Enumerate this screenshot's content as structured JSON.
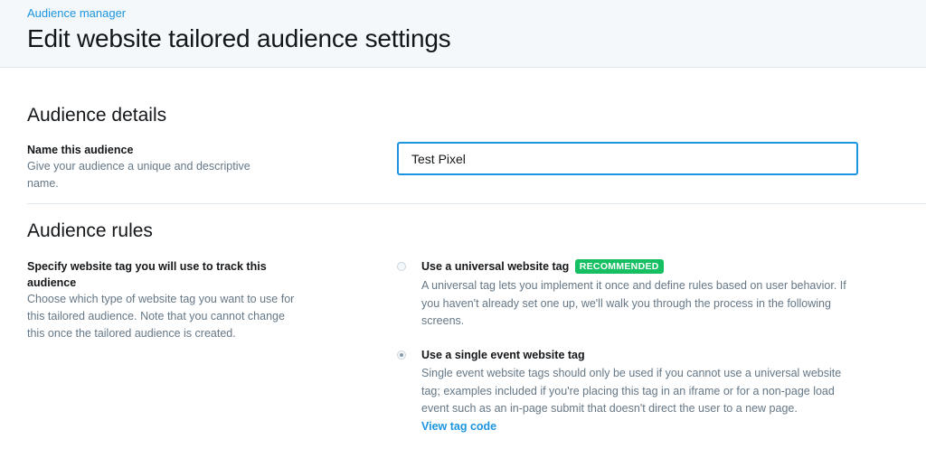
{
  "header": {
    "breadcrumb": "Audience manager",
    "title": "Edit website tailored audience settings"
  },
  "audience_details": {
    "title": "Audience details",
    "name_label": "Name this audience",
    "name_help": "Give your audience a unique and descriptive name.",
    "name_value": "Test Pixel"
  },
  "audience_rules": {
    "title": "Audience rules",
    "tag_label": "Specify website tag you will use to track this audience",
    "tag_help": "Choose which type of website tag you want to use for this tailored audience. Note that you cannot change this once the tailored audience is created.",
    "options": [
      {
        "label": "Use a universal website tag",
        "badge": "RECOMMENDED",
        "description": "A universal tag lets you implement it once and define rules based on user behavior. If you haven't already set one up, we'll walk you through the process in the following screens.",
        "selected": false
      },
      {
        "label": "Use a single event website tag",
        "description": "Single event website tags should only be used if you cannot use a universal website tag; examples included if you're placing this tag in an iframe or for a non-page load event such as an in-page submit that doesn't direct the user to a new page.",
        "selected": true
      }
    ],
    "view_tag_link": "View tag code"
  },
  "colors": {
    "accent": "#1b95e0",
    "badge": "#17bf63",
    "header_bg": "#f5f8fa",
    "muted_text": "#657786"
  }
}
